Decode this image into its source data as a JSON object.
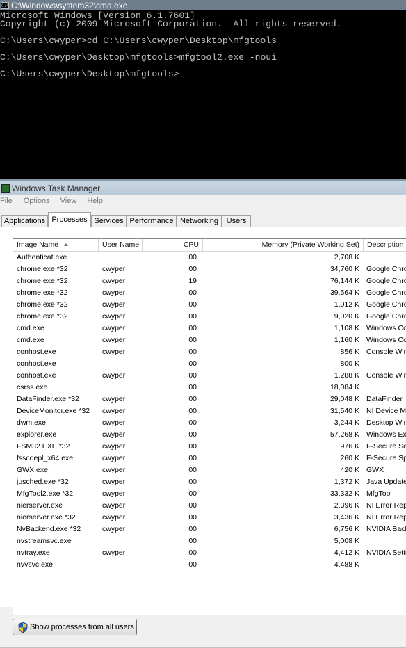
{
  "cmd": {
    "title": "C:\\Windows\\system32\\cmd.exe",
    "icon_label": "C:\\",
    "lines": [
      "Microsoft Windows [Version 6.1.7601]",
      "Copyright (c) 2009 Microsoft Corporation.  All rights reserved.",
      "",
      "C:\\Users\\cwyper>cd C:\\Users\\cwyper\\Desktop\\mfgtools",
      "",
      "C:\\Users\\cwyper\\Desktop\\mfgtools>mfgtool2.exe -noui",
      "",
      "C:\\Users\\cwyper\\Desktop\\mfgtools>"
    ]
  },
  "taskmgr": {
    "title": "Windows Task Manager",
    "menu": [
      "File",
      "Options",
      "View",
      "Help"
    ],
    "tabs": [
      "Applications",
      "Processes",
      "Services",
      "Performance",
      "Networking",
      "Users"
    ],
    "active_tab": "Processes",
    "columns": {
      "image": "Image Name",
      "user": "User Name",
      "cpu": "CPU",
      "memory": "Memory (Private Working Set)",
      "description": "Description"
    },
    "rows": [
      {
        "image": "Authenticat.exe",
        "user": "",
        "cpu": "00",
        "memory": "2,708 K",
        "description": ""
      },
      {
        "image": "chrome.exe *32",
        "user": "cwyper",
        "cpu": "00",
        "memory": "34,760 K",
        "description": "Google Chro"
      },
      {
        "image": "chrome.exe *32",
        "user": "cwyper",
        "cpu": "19",
        "memory": "76,144 K",
        "description": "Google Chro"
      },
      {
        "image": "chrome.exe *32",
        "user": "cwyper",
        "cpu": "00",
        "memory": "39,564 K",
        "description": "Google Chro"
      },
      {
        "image": "chrome.exe *32",
        "user": "cwyper",
        "cpu": "00",
        "memory": "1,012 K",
        "description": "Google Chro"
      },
      {
        "image": "chrome.exe *32",
        "user": "cwyper",
        "cpu": "00",
        "memory": "9,020 K",
        "description": "Google Chro"
      },
      {
        "image": "cmd.exe",
        "user": "cwyper",
        "cpu": "00",
        "memory": "1,108 K",
        "description": "Windows Co"
      },
      {
        "image": "cmd.exe",
        "user": "cwyper",
        "cpu": "00",
        "memory": "1,160 K",
        "description": "Windows Co"
      },
      {
        "image": "conhost.exe",
        "user": "cwyper",
        "cpu": "00",
        "memory": "856 K",
        "description": "Console Win"
      },
      {
        "image": "conhost.exe",
        "user": "",
        "cpu": "00",
        "memory": "800 K",
        "description": ""
      },
      {
        "image": "conhost.exe",
        "user": "cwyper",
        "cpu": "00",
        "memory": "1,288 K",
        "description": "Console Win"
      },
      {
        "image": "csrss.exe",
        "user": "",
        "cpu": "00",
        "memory": "18,084 K",
        "description": ""
      },
      {
        "image": "DataFinder.exe *32",
        "user": "cwyper",
        "cpu": "00",
        "memory": "29,048 K",
        "description": "DataFinder"
      },
      {
        "image": "DeviceMonitor.exe *32",
        "user": "cwyper",
        "cpu": "00",
        "memory": "31,540 K",
        "description": "NI Device M"
      },
      {
        "image": "dwm.exe",
        "user": "cwyper",
        "cpu": "00",
        "memory": "3,244 K",
        "description": "Desktop Win"
      },
      {
        "image": "explorer.exe",
        "user": "cwyper",
        "cpu": "00",
        "memory": "57,268 K",
        "description": "Windows Ex"
      },
      {
        "image": "FSM32.EXE *32",
        "user": "cwyper",
        "cpu": "00",
        "memory": "976 K",
        "description": "F-Secure Se"
      },
      {
        "image": "fsscoepl_x64.exe",
        "user": "cwyper",
        "cpu": "00",
        "memory": "260 K",
        "description": "F-Secure Sp"
      },
      {
        "image": "GWX.exe",
        "user": "cwyper",
        "cpu": "00",
        "memory": "420 K",
        "description": "GWX"
      },
      {
        "image": "jusched.exe *32",
        "user": "cwyper",
        "cpu": "00",
        "memory": "1,372 K",
        "description": "Java Update"
      },
      {
        "image": "MfgTool2.exe *32",
        "user": "cwyper",
        "cpu": "00",
        "memory": "33,332 K",
        "description": "MfgTool"
      },
      {
        "image": "nierserver.exe",
        "user": "cwyper",
        "cpu": "00",
        "memory": "2,396 K",
        "description": "NI Error Rep"
      },
      {
        "image": "nierserver.exe *32",
        "user": "cwyper",
        "cpu": "00",
        "memory": "3,436 K",
        "description": "NI Error Rep"
      },
      {
        "image": "NvBackend.exe *32",
        "user": "cwyper",
        "cpu": "00",
        "memory": "6,756 K",
        "description": "NVIDIA Back"
      },
      {
        "image": "nvstreamsvc.exe",
        "user": "",
        "cpu": "00",
        "memory": "5,008 K",
        "description": ""
      },
      {
        "image": "nvtray.exe",
        "user": "cwyper",
        "cpu": "00",
        "memory": "4,412 K",
        "description": "NVIDIA Setti"
      },
      {
        "image": "nvvsvc.exe",
        "user": "",
        "cpu": "00",
        "memory": "4,488 K",
        "description": ""
      }
    ],
    "show_all_button": "Show processes from all users"
  },
  "colors": {
    "cmd_background": "#000000",
    "cmd_text": "#c0c0c0",
    "titlebar_inactive": "#6e7e8c"
  }
}
